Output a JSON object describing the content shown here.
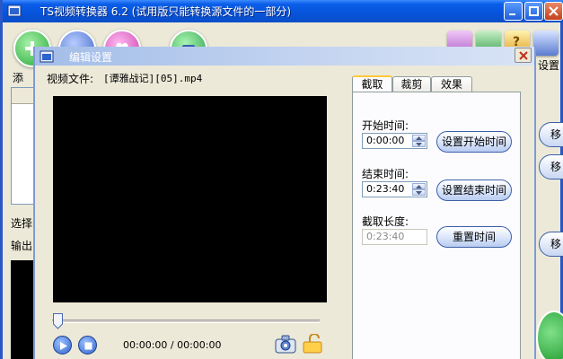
{
  "main_window": {
    "title": "TS视频转换器 6.2 (试用版只能转换源文件的一部分)",
    "toolbar_left_label": "添",
    "toolbar_right_label": "设置",
    "list_label": "选择",
    "output_label": "输出",
    "side_buttons": [
      "移",
      "移",
      "移"
    ]
  },
  "dialog": {
    "title": "编辑设置",
    "file_label": "视频文件:",
    "file_name": "[谭雅战记][05].mp4",
    "tabs": [
      "截取",
      "裁剪",
      "效果"
    ],
    "active_tab": "截取",
    "start_label": "开始时间:",
    "start_value": "0:00:00",
    "set_start_button": "设置开始时间",
    "end_label": "结束时间:",
    "end_value": "0:23:40",
    "set_end_button": "设置结束时间",
    "length_label": "截取长度:",
    "length_value": "0:23:40",
    "reset_button": "重置时间",
    "time_readout": "00:00:00  /  00:00:00"
  },
  "colors": {
    "title_blue": "#0753db",
    "dialog_title": "#c6d6f1",
    "window_bg": "#ece9d8",
    "video_bg": "#000000",
    "tab_accent": "#ffc83c"
  }
}
